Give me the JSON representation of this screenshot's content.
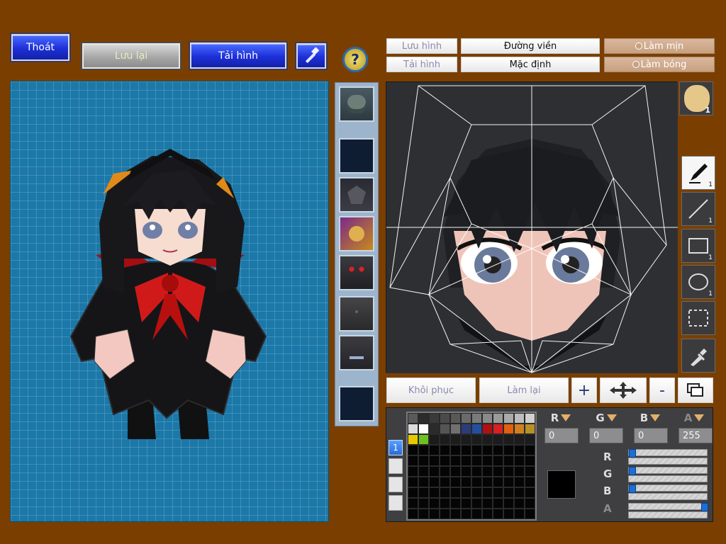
{
  "top_left": {
    "exit_label": "Thoát",
    "save_label": "Lưu lại",
    "load_label": "Tải hình"
  },
  "editor_top": {
    "save_image_label": "Lưu hình",
    "load_image_label": "Tải hình",
    "outline_label": "Đường viền",
    "default_label": "Mặc định",
    "smooth_label": "Làm mịn",
    "shade_label": "Làm bóng"
  },
  "tools": [
    {
      "name": "pen-tool",
      "count": "1"
    },
    {
      "name": "line-tool",
      "count": "1"
    },
    {
      "name": "rectangle-tool",
      "count": "1"
    },
    {
      "name": "ellipse-tool",
      "count": "1"
    },
    {
      "name": "select-tool",
      "count": ""
    },
    {
      "name": "eyedropper-tool",
      "count": ""
    }
  ],
  "avatar_count": "1",
  "edit_actions": {
    "restore_label": "Khôi phục",
    "redo_label": "Làm lại",
    "zoom_in": "+",
    "zoom_out": "-"
  },
  "palette_tab": "1",
  "color": {
    "r": "0",
    "g": "0",
    "b": "0",
    "a": "255",
    "r_slider": 0,
    "g_slider": 0,
    "b_slider": 0,
    "a_slider": 1,
    "current_hex": "#000000"
  },
  "palette_colors": [
    "#5a5a5a",
    "#2c2c2c",
    "#3a3a3a",
    "#4a4a4a",
    "#585858",
    "#6a6a6a",
    "#7a7a7a",
    "#8a8a8a",
    "#9a9a9a",
    "#aaaaaa",
    "#bdbdbd",
    "#d0d0d0",
    "#dcdcdc",
    "#ffffff",
    "#2b2b2b",
    "#555555",
    "#707070",
    "#2a3c7a",
    "#234fa0",
    "#b01010",
    "#d82020",
    "#e06010",
    "#d08020",
    "#b89028",
    "#e8c800",
    "#70c020",
    "#1c1c1c",
    "#1c1c1c",
    "#1c1c1c",
    "#1c1c1c",
    "#1c1c1c",
    "#1c1c1c",
    "#1c1c1c",
    "#1c1c1c",
    "#1c1c1c",
    "#1c1c1c"
  ]
}
